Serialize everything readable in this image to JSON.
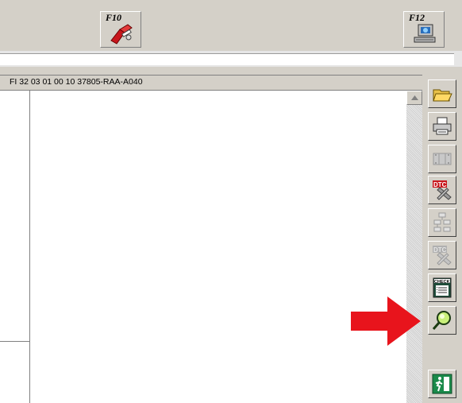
{
  "toolbar_top": {
    "f10": {
      "label": "F10",
      "icon": "wrench-toolkit-icon"
    },
    "f12": {
      "label": "F12",
      "icon": "computer-network-icon"
    }
  },
  "panel": {
    "header_text": "FI  32 03 01 00 10  37805-RAA-A040"
  },
  "side_toolbar": {
    "buttons": [
      {
        "icon": "open-folder-icon"
      },
      {
        "icon": "printer-icon"
      },
      {
        "icon": "film-strip-icon"
      },
      {
        "icon": "dtc-tools-icon",
        "label": "DTC"
      },
      {
        "icon": "flowchart-icon"
      },
      {
        "icon": "dtc-disabled-icon",
        "label": "DTC"
      },
      {
        "icon": "checklist-icon",
        "label": "CHECK"
      },
      {
        "icon": "magnifier-icon"
      },
      {
        "icon": "exit-icon"
      }
    ]
  },
  "colors": {
    "arrow": "#e8141c",
    "panel_bg": "#d4d0c8"
  }
}
